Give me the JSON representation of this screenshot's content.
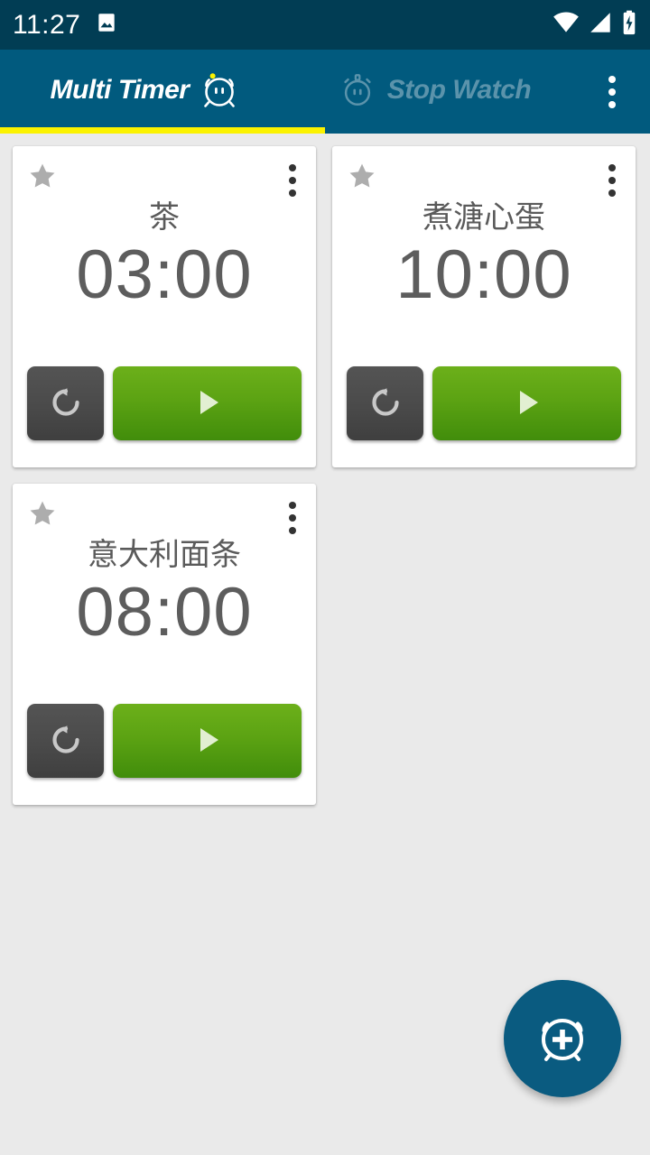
{
  "status_bar": {
    "time": "11:27",
    "icons": [
      "image-icon",
      "wifi-icon",
      "cellular-signal-icon",
      "battery-charging-icon"
    ],
    "background_color": "#013d54"
  },
  "app_bar": {
    "background_color": "#015a7e",
    "indicator_color": "#fbf200",
    "tabs": [
      {
        "label": "Multi Timer",
        "icon": "alarm-clock-face-icon",
        "active": true
      },
      {
        "label": "Stop Watch",
        "icon": "stopwatch-face-icon",
        "active": false
      }
    ],
    "overflow_menu": "more-options-icon"
  },
  "timers": [
    {
      "title": "茶",
      "time": "03:00",
      "favorite_icon": "star-icon",
      "menu_icon": "more-options-icon",
      "reset_label": "reset-icon",
      "start_label": "play-icon"
    },
    {
      "title": "煮溏心蛋",
      "time": "10:00",
      "favorite_icon": "star-icon",
      "menu_icon": "more-options-icon",
      "reset_label": "reset-icon",
      "start_label": "play-icon"
    },
    {
      "title": "意大利面条",
      "time": "08:00",
      "favorite_icon": "star-icon",
      "menu_icon": "more-options-icon",
      "reset_label": "reset-icon",
      "start_label": "play-icon"
    }
  ],
  "fab": {
    "icon": "add-alarm-icon",
    "color": "#0a5b80"
  },
  "theme": {
    "page_background": "#eaeaea",
    "card_background": "#ffffff",
    "text_gray": "#5a5a5a",
    "star_gray": "#adadad",
    "green_button": "#5ca313",
    "dark_button": "#4a4a4a"
  }
}
